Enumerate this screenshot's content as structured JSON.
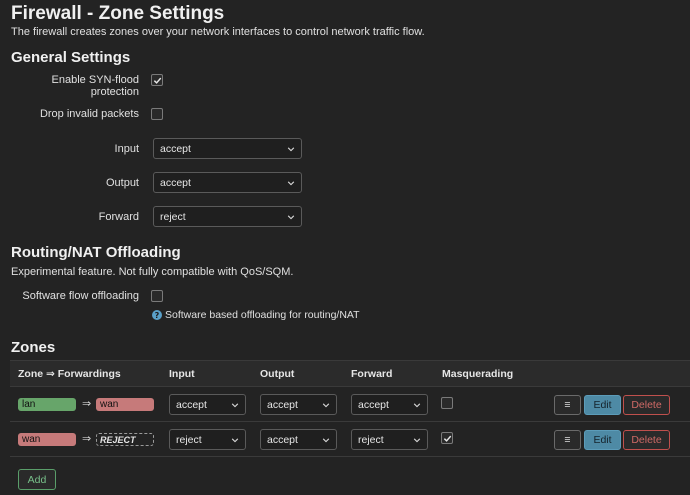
{
  "page": {
    "title": "Firewall - Zone Settings",
    "description": "The firewall creates zones over your network interfaces to control network traffic flow."
  },
  "general": {
    "heading": "General Settings",
    "syn_flood_label": "Enable SYN-flood protection",
    "syn_flood_checked": true,
    "drop_invalid_label": "Drop invalid packets",
    "drop_invalid_checked": false,
    "input_label": "Input",
    "input_value": "accept",
    "output_label": "Output",
    "output_value": "accept",
    "forward_label": "Forward",
    "forward_value": "reject"
  },
  "offloading": {
    "heading": "Routing/NAT Offloading",
    "description": "Experimental feature. Not fully compatible with QoS/SQM.",
    "sw_label": "Software flow offloading",
    "sw_checked": false,
    "hint": "Software based offloading for routing/NAT"
  },
  "zones": {
    "heading": "Zones",
    "columns": {
      "zone": "Zone ⇒ Forwardings",
      "input": "Input",
      "output": "Output",
      "forward": "Forward",
      "masq": "Masquerading"
    },
    "rows": [
      {
        "zone": "lan",
        "zone_color": "#67a56a",
        "arrow": "⇒",
        "target": "wan",
        "target_color": "#c67a7a",
        "target_type": "zone",
        "input": "accept",
        "output": "accept",
        "forward": "accept",
        "masq": false
      },
      {
        "zone": "wan",
        "zone_color": "#c67a7a",
        "arrow": "⇒",
        "target": "REJECT",
        "target_type": "reject",
        "input": "reject",
        "output": "accept",
        "forward": "reject",
        "masq": true
      }
    ],
    "menu_label": "≡",
    "edit_label": "Edit",
    "delete_label": "Delete",
    "add_label": "Add"
  }
}
